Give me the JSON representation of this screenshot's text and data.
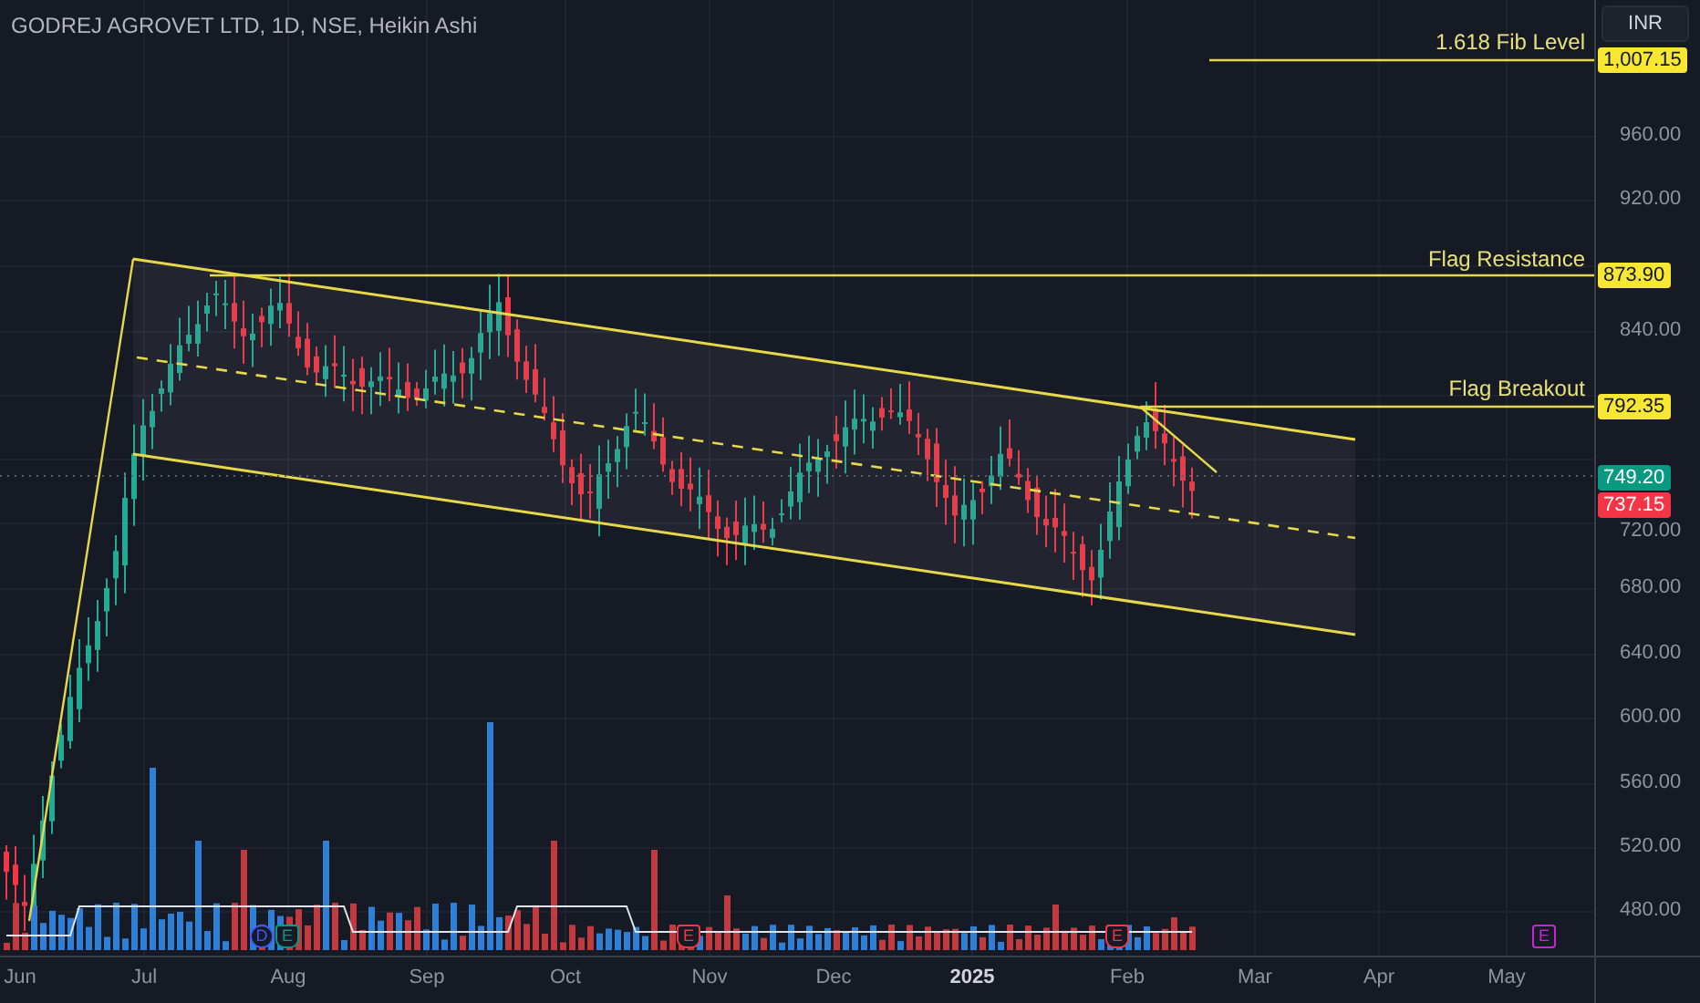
{
  "header": {
    "title": "GODREJ AGROVET LTD, 1D, NSE, Heikin Ashi"
  },
  "currency_button": {
    "label": "INR"
  },
  "level_labels": [
    {
      "text": "1.618 Fib Level"
    },
    {
      "text": "Flag Resistance"
    },
    {
      "text": "Flag Breakout"
    }
  ],
  "price_axis": {
    "ticks": [
      "960.00",
      "920.00",
      "840.00",
      "720.00",
      "680.00",
      "640.00",
      "600.00",
      "560.00",
      "520.00",
      "480.00"
    ]
  },
  "price_tags": [
    {
      "text": "1,007.15",
      "color": "#f7e733"
    },
    {
      "text": "873.90",
      "color": "#f7e733"
    },
    {
      "text": "792.35",
      "color": "#f7e733"
    },
    {
      "text": "749.20",
      "color": "#089981"
    },
    {
      "text": "737.15",
      "color": "#f23645"
    }
  ],
  "time_axis": {
    "labels": [
      {
        "text": "Jun",
        "kind": "month"
      },
      {
        "text": "Jul",
        "kind": "month"
      },
      {
        "text": "Aug",
        "kind": "month"
      },
      {
        "text": "Sep",
        "kind": "month"
      },
      {
        "text": "Oct",
        "kind": "month"
      },
      {
        "text": "Nov",
        "kind": "month"
      },
      {
        "text": "Dec",
        "kind": "month"
      },
      {
        "text": "2025",
        "kind": "year"
      },
      {
        "text": "Feb",
        "kind": "month"
      },
      {
        "text": "Mar",
        "kind": "month"
      },
      {
        "text": "Apr",
        "kind": "month"
      },
      {
        "text": "May",
        "kind": "month"
      }
    ]
  },
  "event_markers": [
    {
      "letter": "D",
      "kind": "dividend",
      "color": "#3d5afe"
    },
    {
      "letter": "E",
      "kind": "earnings",
      "color": "#089981"
    },
    {
      "letter": "E",
      "kind": "earnings",
      "color": "#f23645"
    },
    {
      "letter": "E",
      "kind": "earnings",
      "color": "#f23645"
    },
    {
      "letter": "E",
      "kind": "upcoming",
      "color": "#c626d6"
    }
  ]
}
